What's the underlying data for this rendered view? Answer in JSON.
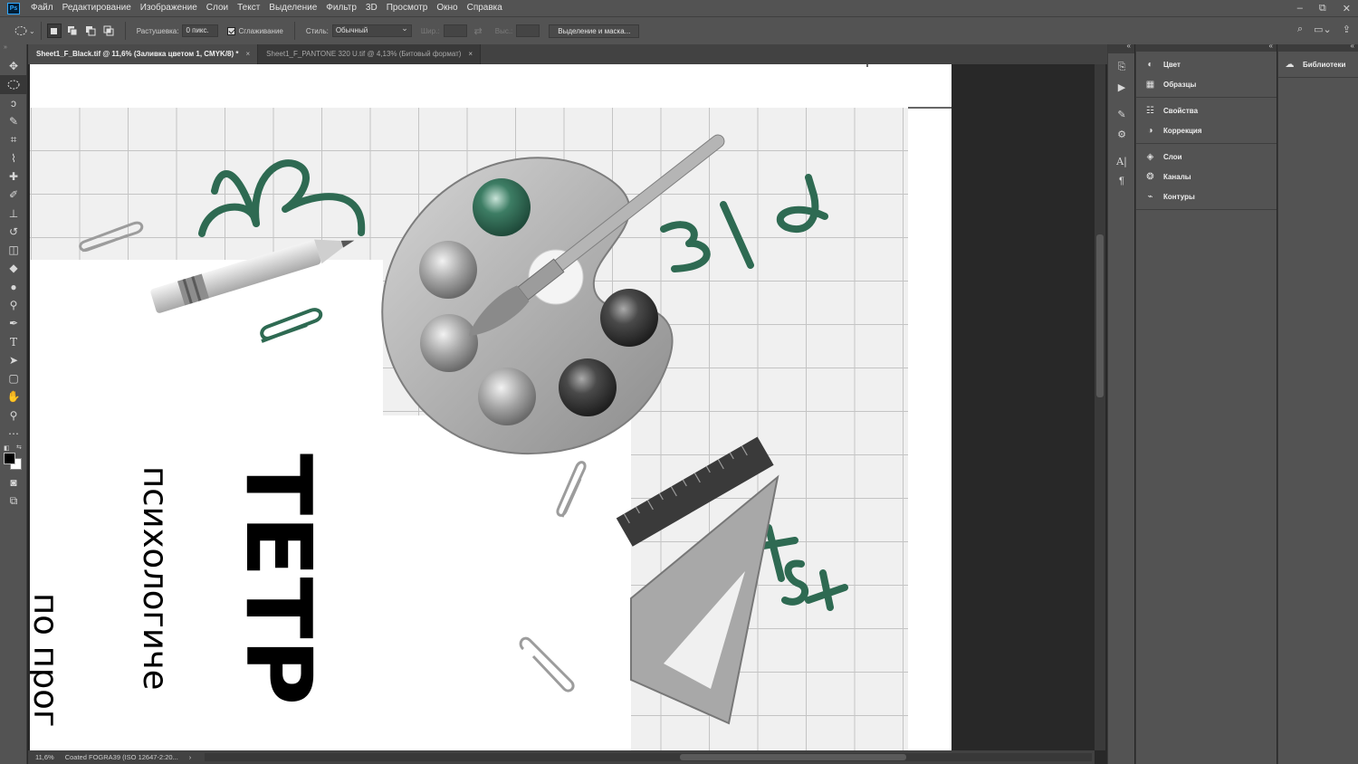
{
  "app": {
    "logo": "Ps"
  },
  "menu": [
    "Файл",
    "Редактирование",
    "Изображение",
    "Слои",
    "Текст",
    "Выделение",
    "Фильтр",
    "3D",
    "Просмотр",
    "Окно",
    "Справка"
  ],
  "window_controls": {
    "minimize": "–",
    "restore": "⧉",
    "close": "✕"
  },
  "options": {
    "feather_label": "Растушевка:",
    "feather_value": "0 пикс.",
    "antialias_label": "Сглаживание",
    "style_label": "Стиль:",
    "style_value": "Обычный",
    "width_label": "Шир.:",
    "height_label": "Выс.:",
    "swap_icon": "⇄",
    "mask_button": "Выделение и маска..."
  },
  "tabs": [
    {
      "label": "Sheet1_F_Black.tif @ 11,6% (Заливка цветом 1, CMYK/8) *",
      "close": "×",
      "active": true
    },
    {
      "label": "Sheet1_F_PANTONE 320 U.tif @ 4,13% (Битовый формат)",
      "close": "×",
      "active": false
    }
  ],
  "document_text": {
    "title": "ТЕТР",
    "line2": "психологиче",
    "line3": "по прог"
  },
  "status": {
    "zoom": "11,6%",
    "profile": "Coated FOGRA39 (ISO 12647-2:20...",
    "arrow": "›"
  },
  "panels": {
    "group1": [
      {
        "label": "Цвет",
        "icon": "color-wheel-icon"
      },
      {
        "label": "Образцы",
        "icon": "swatches-grid-icon"
      }
    ],
    "group2": [
      {
        "label": "Свойства",
        "icon": "properties-icon"
      },
      {
        "label": "Коррекция",
        "icon": "adjustments-icon"
      }
    ],
    "group3": [
      {
        "label": "Слои",
        "icon": "layers-icon"
      },
      {
        "label": "Каналы",
        "icon": "channels-icon"
      },
      {
        "label": "Контуры",
        "icon": "paths-icon"
      }
    ],
    "libraries": {
      "label": "Библиотеки",
      "icon": "cloud-libraries-icon"
    }
  },
  "colors": {
    "accent_green": "#2e6a52",
    "ps_blue": "#31a8ff",
    "chrome_dark": "#535353"
  }
}
